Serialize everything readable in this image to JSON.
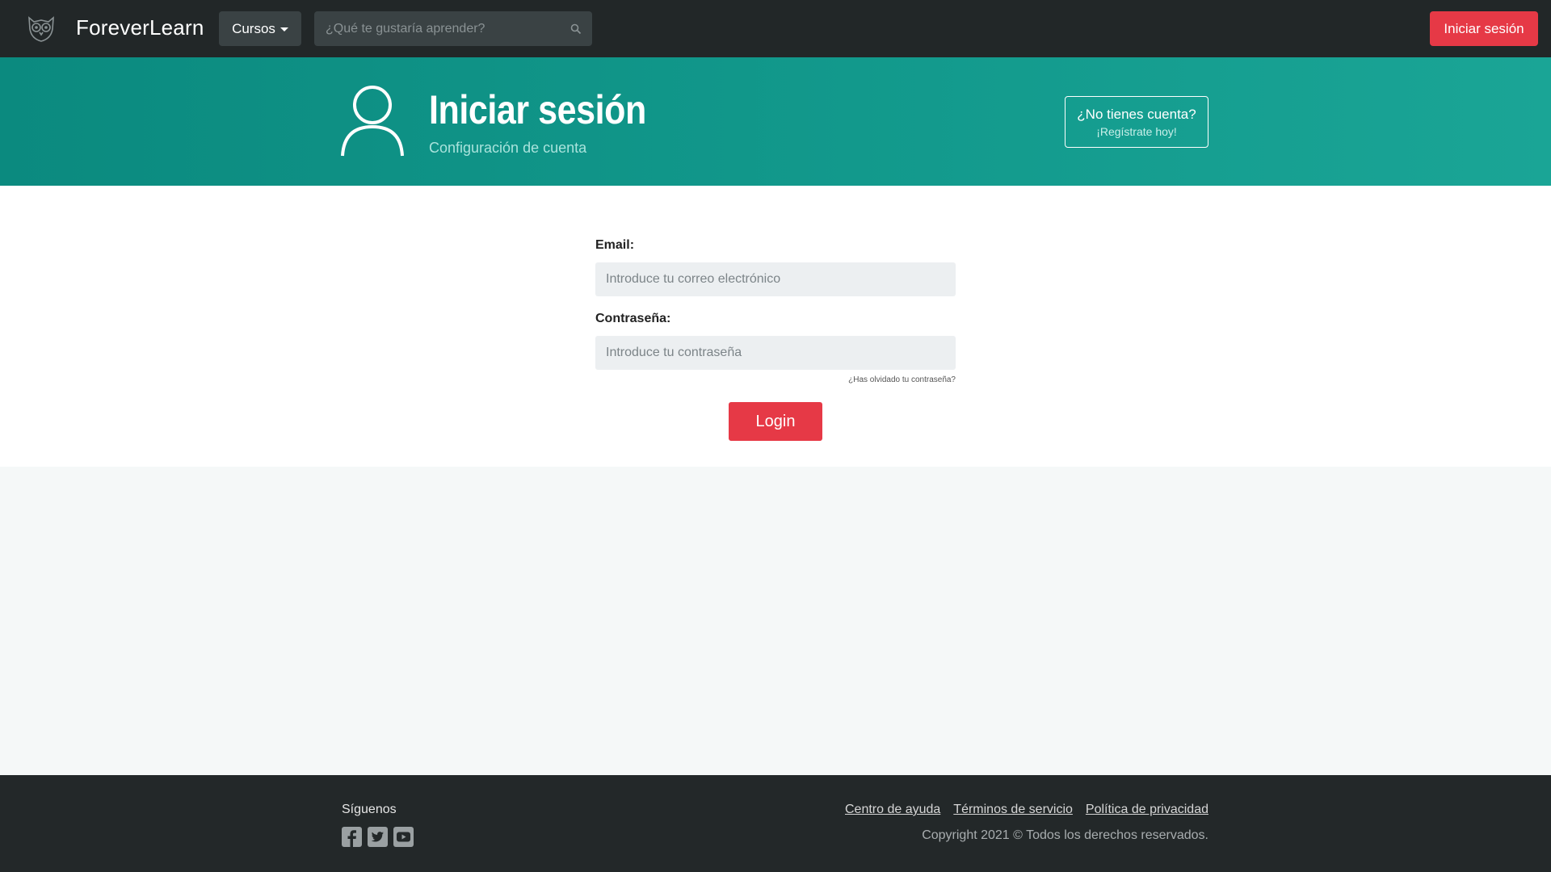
{
  "navbar": {
    "logo_icon": "owl-logo-icon",
    "brand": "ForeverLearn",
    "courses_label": "Cursos",
    "search_placeholder": "¿Qué te gustaría aprender?",
    "search_icon": "search-icon",
    "login_label": "Iniciar sesión"
  },
  "hero": {
    "icon": "user-icon",
    "title": "Iniciar sesión",
    "subtitle": "Configuración de cuenta",
    "register_question": "¿No tienes cuenta?",
    "register_cta": "¡Regístrate hoy!"
  },
  "form": {
    "email_label": "Email:",
    "email_placeholder": "Introduce tu correo electrónico",
    "email_value": "",
    "password_label": "Contraseña:",
    "password_placeholder": "Introduce tu contraseña",
    "password_value": "",
    "forgot_label": "¿Has olvidado tu contraseña?",
    "submit_label": "Login"
  },
  "footer": {
    "follow_label": "Síguenos",
    "social_icons": [
      "facebook-icon",
      "twitter-icon",
      "youtube-icon"
    ],
    "links": [
      "Centro de ayuda",
      "Términos de servicio",
      "Política de privacidad"
    ],
    "copyright": "Copyright 2021 © Todos los derechos reservados."
  },
  "colors": {
    "navbar_bg": "#222728",
    "accent_red": "#e63946",
    "hero_teal": "#12998c",
    "footer_bg": "#232829"
  }
}
